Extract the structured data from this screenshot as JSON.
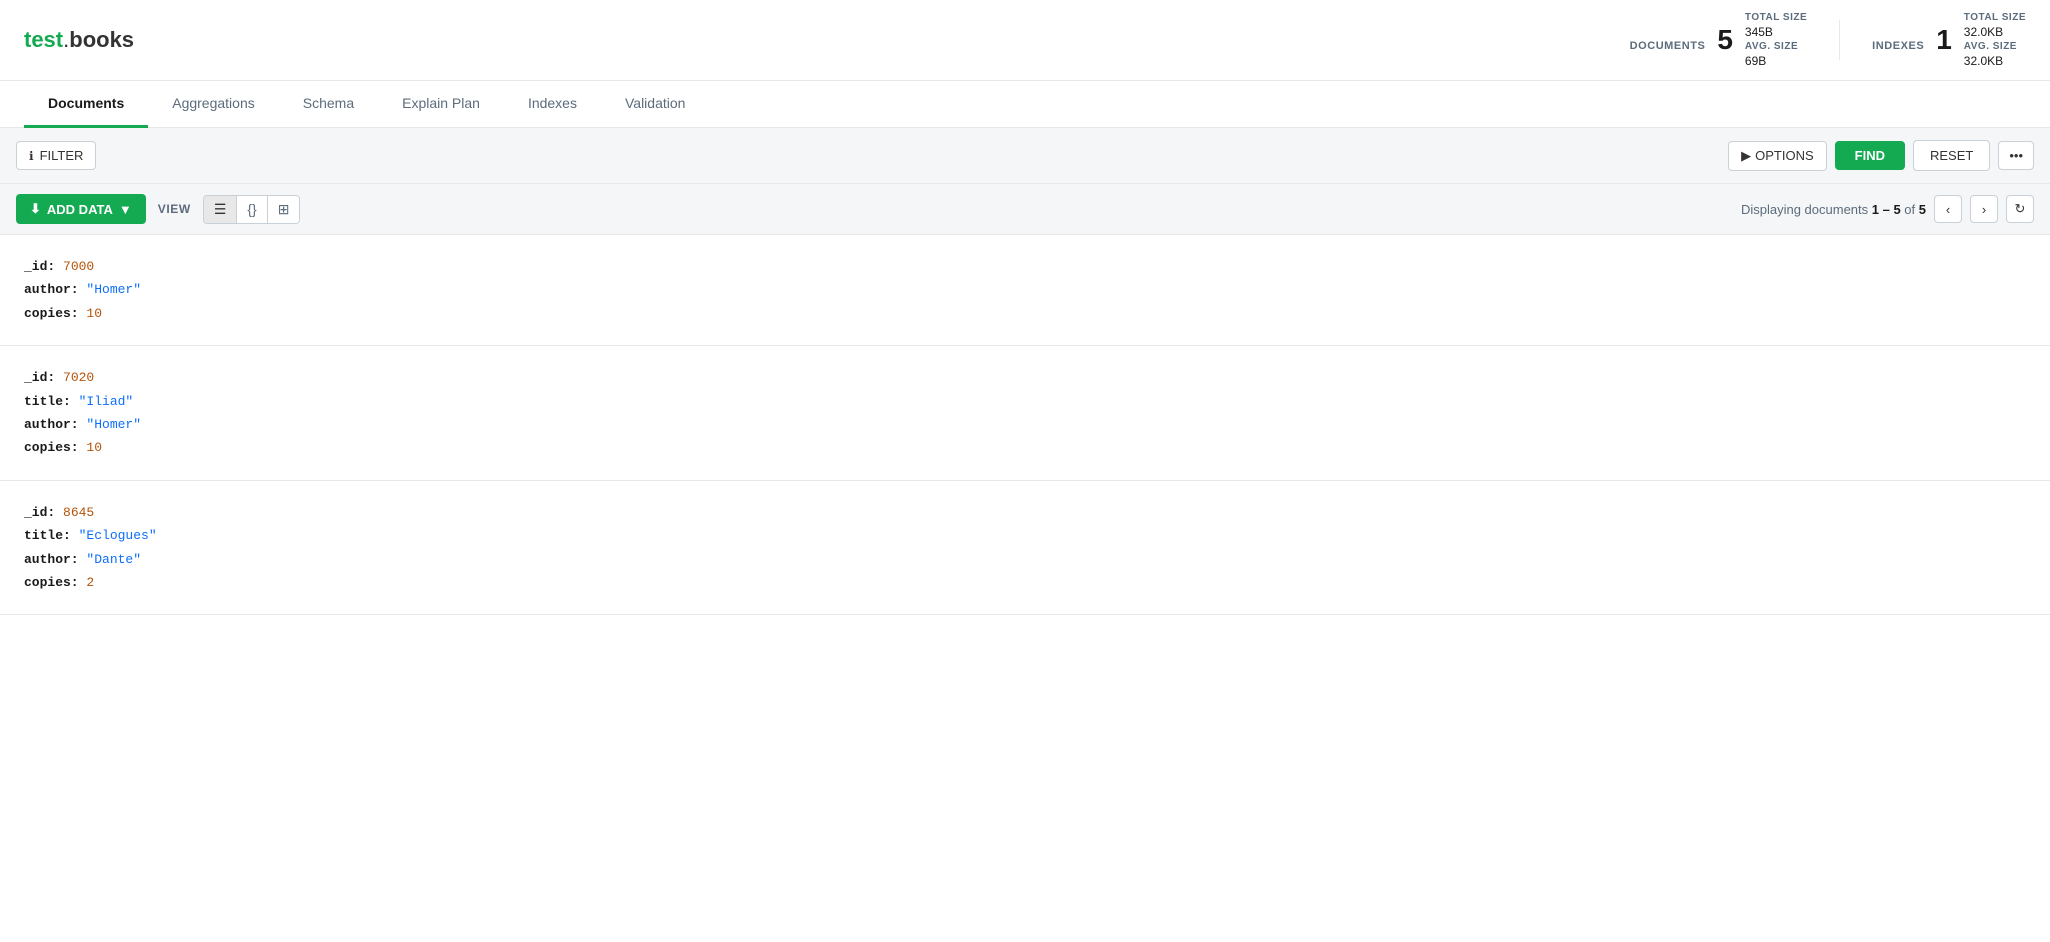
{
  "header": {
    "title": "test.books",
    "title_prefix": "test",
    "title_dot": ".",
    "title_suffix": "books"
  },
  "stats": {
    "documents_label": "DOCUMENTS",
    "documents_count": "5",
    "documents_total_size_label": "TOTAL SIZE",
    "documents_total_size": "345B",
    "documents_avg_size_label": "AVG. SIZE",
    "documents_avg_size": "69B",
    "indexes_label": "INDEXES",
    "indexes_count": "1",
    "indexes_total_size_label": "TOTAL SIZE",
    "indexes_total_size": "32.0KB",
    "indexes_avg_size_label": "AVG. SIZE",
    "indexes_avg_size": "32.0KB"
  },
  "tabs": [
    {
      "id": "documents",
      "label": "Documents",
      "active": true
    },
    {
      "id": "aggregations",
      "label": "Aggregations",
      "active": false
    },
    {
      "id": "schema",
      "label": "Schema",
      "active": false
    },
    {
      "id": "explain-plan",
      "label": "Explain Plan",
      "active": false
    },
    {
      "id": "indexes",
      "label": "Indexes",
      "active": false
    },
    {
      "id": "validation",
      "label": "Validation",
      "active": false
    }
  ],
  "filter_bar": {
    "filter_label": "FILTER",
    "options_label": "OPTIONS",
    "find_label": "FIND",
    "reset_label": "RESET",
    "more_label": "•••"
  },
  "toolbar": {
    "add_data_label": "ADD DATA",
    "view_label": "VIEW",
    "display_text": "Displaying documents ",
    "display_range": "1 – 5",
    "display_of": " of ",
    "display_total": "5"
  },
  "documents": [
    {
      "id": "doc-1",
      "fields": [
        {
          "key": "_id",
          "value": "7000",
          "type": "num"
        },
        {
          "key": "author",
          "value": "\"Homer\"",
          "type": "str"
        },
        {
          "key": "copies",
          "value": "10",
          "type": "num"
        }
      ]
    },
    {
      "id": "doc-2",
      "fields": [
        {
          "key": "_id",
          "value": "7020",
          "type": "num"
        },
        {
          "key": "title",
          "value": "\"Iliad\"",
          "type": "str"
        },
        {
          "key": "author",
          "value": "\"Homer\"",
          "type": "str"
        },
        {
          "key": "copies",
          "value": "10",
          "type": "num"
        }
      ]
    },
    {
      "id": "doc-3",
      "fields": [
        {
          "key": "_id",
          "value": "8645",
          "type": "num"
        },
        {
          "key": "title",
          "value": "\"Eclogues\"",
          "type": "str"
        },
        {
          "key": "author",
          "value": "\"Dante\"",
          "type": "str"
        },
        {
          "key": "copies",
          "value": "2",
          "type": "num"
        }
      ]
    }
  ]
}
